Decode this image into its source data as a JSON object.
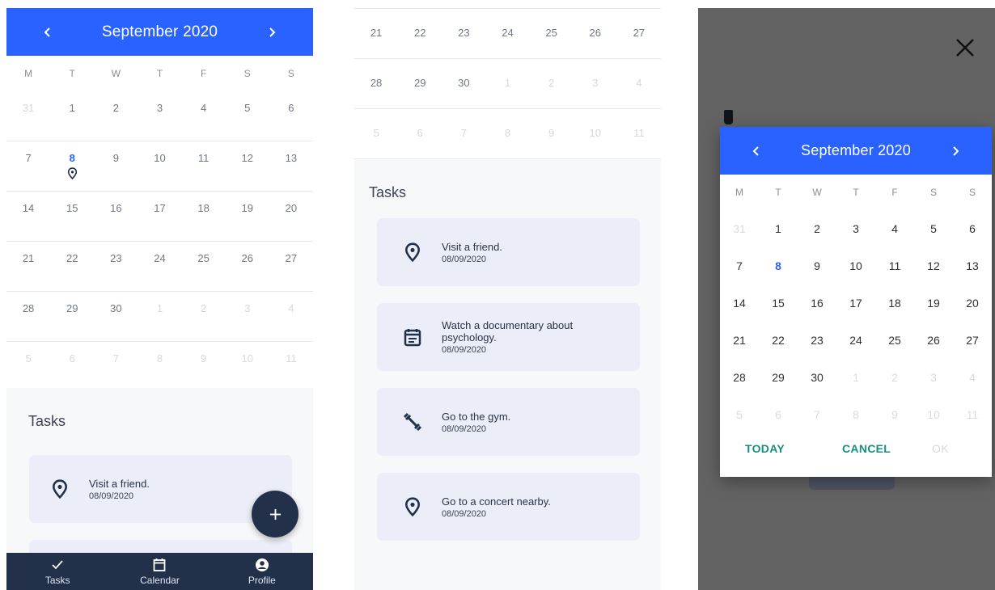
{
  "colors": {
    "accent": "#2962FF",
    "navy": "#223049",
    "teal": "#14907F",
    "overlay": "#636363"
  },
  "calendar": {
    "month_title": "September 2020",
    "prev_icon": "chevron-left-icon",
    "next_icon": "chevron-right-icon",
    "weekdays": [
      "M",
      "T",
      "W",
      "T",
      "F",
      "S",
      "S"
    ],
    "weeks": [
      [
        "31",
        "1",
        "2",
        "3",
        "4",
        "5",
        "6"
      ],
      [
        "7",
        "8",
        "9",
        "10",
        "11",
        "12",
        "13"
      ],
      [
        "14",
        "15",
        "16",
        "17",
        "18",
        "19",
        "20"
      ],
      [
        "21",
        "22",
        "23",
        "24",
        "25",
        "26",
        "27"
      ],
      [
        "28",
        "29",
        "30",
        "1",
        "2",
        "3",
        "4"
      ],
      [
        "5",
        "6",
        "7",
        "8",
        "9",
        "10",
        "11"
      ]
    ],
    "today": "8"
  },
  "tasks_heading": "Tasks",
  "tasks": [
    {
      "title": "Visit a friend.",
      "date": "08/09/2020",
      "icon": "location-pin-icon"
    },
    {
      "title": "Watch a documentary about psychology.",
      "date": "08/09/2020",
      "icon": "calendar-note-icon"
    },
    {
      "title": "Go to the gym.",
      "date": "08/09/2020",
      "icon": "dumbbell-icon"
    },
    {
      "title": "Go to a concert nearby.",
      "date": "08/09/2020",
      "icon": "location-pin-icon"
    }
  ],
  "fab": {
    "icon": "plus-icon"
  },
  "bottom_nav": [
    {
      "label": "Tasks",
      "icon": "check-icon"
    },
    {
      "label": "Calendar",
      "icon": "calendar-icon"
    },
    {
      "label": "Profile",
      "icon": "profile-icon"
    }
  ],
  "dialog": {
    "today_label": "TODAY",
    "cancel_label": "CANCEL",
    "ok_label": "OK",
    "close_icon": "close-icon"
  }
}
